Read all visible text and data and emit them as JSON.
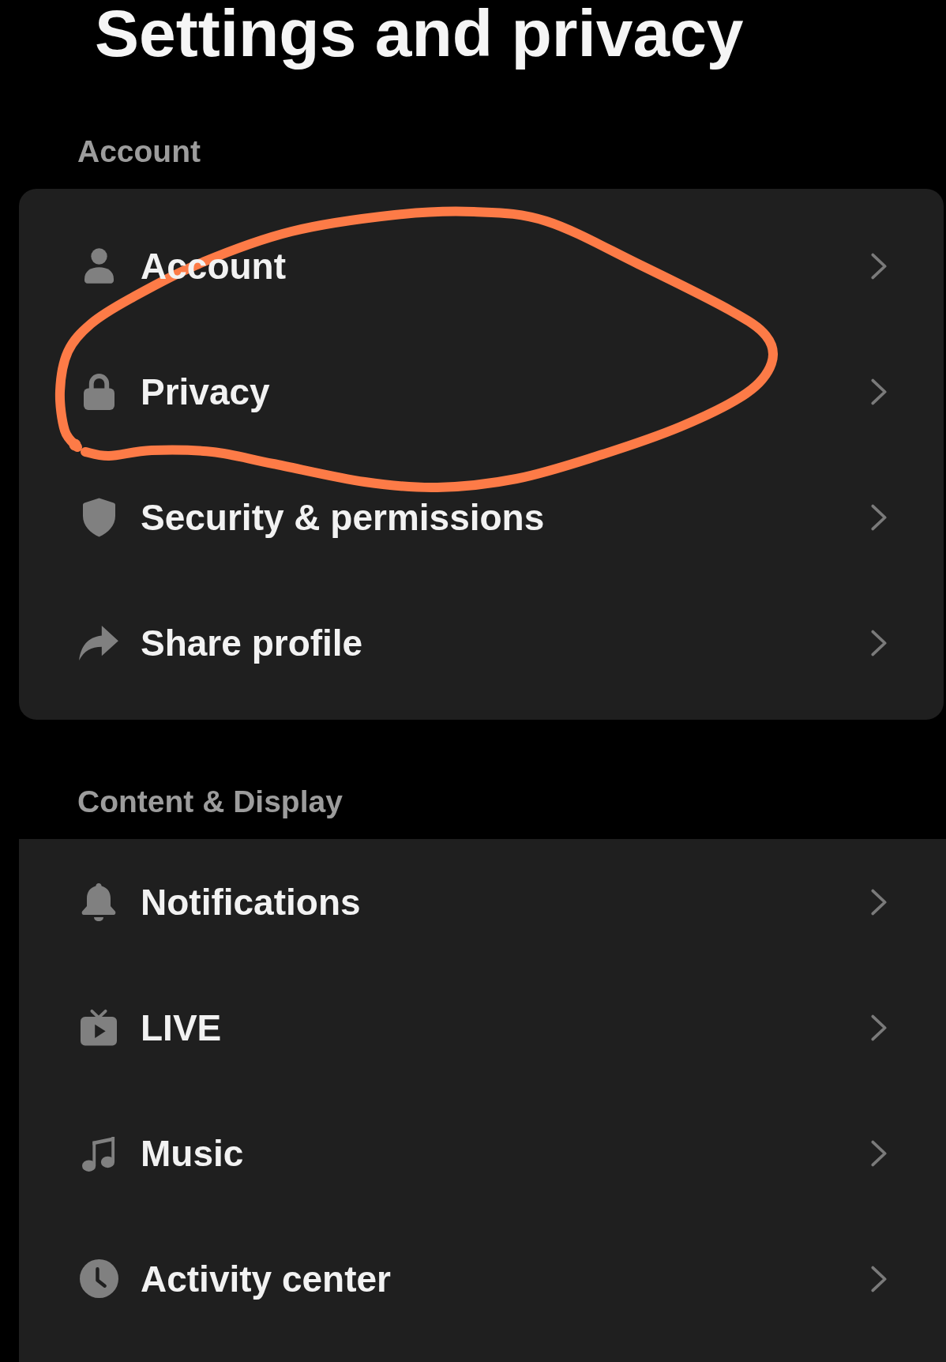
{
  "title": "Settings and privacy",
  "sections": [
    {
      "header": "Account",
      "items": [
        "Account",
        "Privacy",
        "Security & permissions",
        "Share profile"
      ]
    },
    {
      "header": "Content & Display",
      "items": [
        "Notifications",
        "LIVE",
        "Music",
        "Activity center"
      ]
    }
  ],
  "annotation": {
    "kind": "loop"
  }
}
